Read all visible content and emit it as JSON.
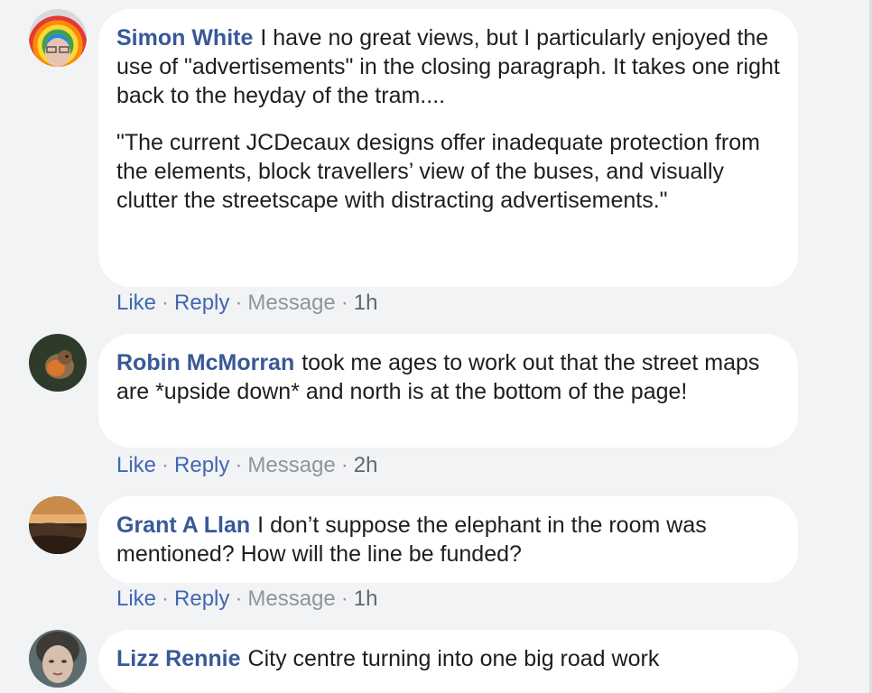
{
  "comments": [
    {
      "author": "Simon White",
      "paragraphs": [
        "I have no great views, but I particularly enjoyed the use of \"advertisements\" in the closing paragraph. It takes one right back to the heyday of the tram....",
        "\"The current JCDecaux designs offer inadequate protection from the elements, block travellers’ view of the buses, and visually clutter the streetscape with distracting advertisements.\""
      ],
      "actions": {
        "like": "Like",
        "reply": "Reply",
        "message": "Message",
        "time": "1h"
      }
    },
    {
      "author": "Robin McMorran",
      "text": "took me ages to work out that the street maps are *upside down* and north is at the bottom of the page!",
      "actions": {
        "like": "Like",
        "reply": "Reply",
        "message": "Message",
        "time": "2h"
      }
    },
    {
      "author": "Grant A Llan",
      "text": "I don’t suppose the elephant in the room was mentioned? How will the line be funded?",
      "actions": {
        "like": "Like",
        "reply": "Reply",
        "message": "Message",
        "time": "1h"
      }
    },
    {
      "author": "Lizz Rennie",
      "text": "City centre turning into one big road work"
    }
  ],
  "separator": "·",
  "colors": {
    "author": "#385898",
    "link": "#4267b2",
    "muted": "#90949c",
    "bubble": "#ffffff",
    "background": "#f2f3f5"
  }
}
